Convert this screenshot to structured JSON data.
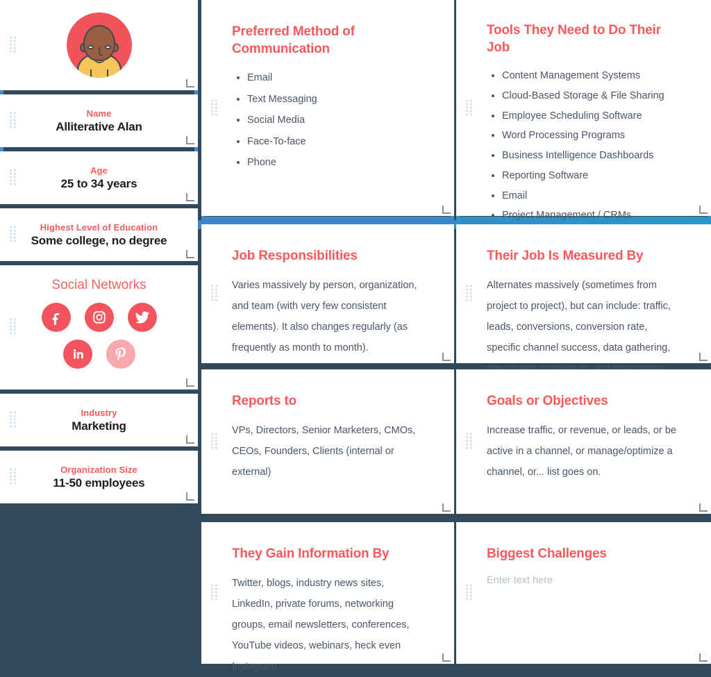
{
  "colors": {
    "accent_red": "#f9595c",
    "body_text": "#48566a",
    "page_background": "#32495c",
    "selection_blue_left": "#4a89cc",
    "selection_blue_mid": "#3d8bcd",
    "selection_blue_right": "#2a95c6",
    "social_icon": "#f2535c",
    "social_icon_faded": "#f8a9ae"
  },
  "left_column": {
    "avatar": {
      "icon": "persona-avatar-illustration"
    },
    "fields": [
      {
        "label": "Name",
        "value": "Alliterative Alan"
      },
      {
        "label": "Age",
        "value": "25 to 34 years"
      },
      {
        "label": "Highest Level of Education",
        "value": "Some college, no degree"
      },
      {
        "label": "Industry",
        "value": "Marketing"
      },
      {
        "label": "Organization Size",
        "value": "11-50 employees"
      }
    ],
    "social": {
      "title": "Social Networks",
      "networks": [
        {
          "name": "Facebook",
          "icon": "facebook-icon",
          "active": true
        },
        {
          "name": "Instagram",
          "icon": "instagram-icon",
          "active": true
        },
        {
          "name": "Twitter",
          "icon": "twitter-icon",
          "active": true
        },
        {
          "name": "LinkedIn",
          "icon": "linkedin-icon",
          "active": true
        },
        {
          "name": "Pinterest",
          "icon": "pinterest-icon",
          "active": false
        }
      ]
    }
  },
  "middle_column": {
    "communication": {
      "title": "Preferred Method of Communication",
      "items": [
        "Email",
        "Text Messaging",
        "Social Media",
        "Face-To-face",
        "Phone"
      ]
    },
    "responsibilities": {
      "title": "Job Responsibilities",
      "body": "Varies massively by person, organization, and team (with very few consistent elements). It also changes regularly (as frequently as month to month)."
    },
    "reports_to": {
      "title": "Reports to",
      "body": "VPs, Directors, Senior Marketers, CMOs, CEOs, Founders, Clients (internal or external)"
    },
    "information": {
      "title": "They Gain Information By",
      "body": "Twitter, blogs, industry news sites, LinkedIn, private forums, networking groups, email newsletters, conferences, YouTube videos, webinars, heck even Instagram"
    }
  },
  "right_column": {
    "tools": {
      "title": "Tools They Need to Do Their Job",
      "items": [
        "Content Management Systems",
        "Cloud-Based Storage & File Sharing",
        "Employee Scheduling Software",
        "Word Processing Programs",
        "Business Intelligence Dashboards",
        "Reporting Software",
        "Email",
        "Project Management / CRMs"
      ]
    },
    "measured_by": {
      "title": "Their Job Is Measured By",
      "body": "Alternates massively (sometimes from project to project), but can include: traffic, leads, conversions, conversion rate, specific channel success, data gathering, raw project completion, and many more."
    },
    "goals": {
      "title": "Goals or Objectives",
      "body": "Increase traffic, or revenue, or leads, or be active in a channel, or manage/optimize a channel, or... list goes on."
    },
    "challenges": {
      "title": "Biggest Challenges",
      "placeholder": "Enter text here"
    }
  }
}
